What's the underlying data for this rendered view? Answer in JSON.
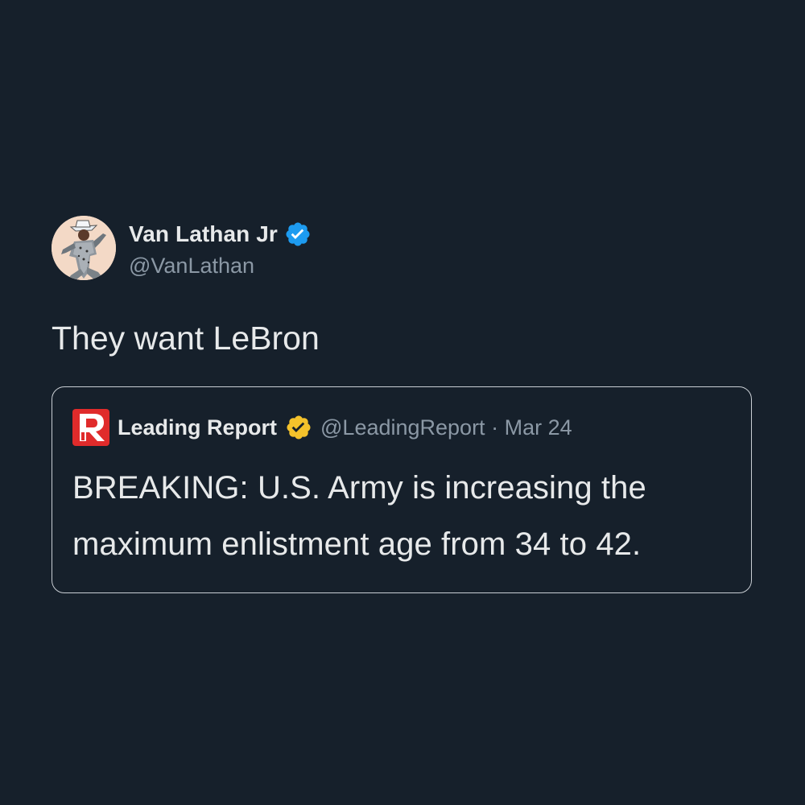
{
  "tweet": {
    "author": {
      "display_name": "Van Lathan Jr",
      "handle": "@VanLathan",
      "verified_color": "#1d9bf0",
      "avatar_icon": "profile-photo"
    },
    "text": "They want LeBron",
    "quoted": {
      "display_name": "Leading Report",
      "handle": "@LeadingReport",
      "separator": "·",
      "date": "Mar 24",
      "logo_letter": "R",
      "logo_color": "#e02b2b",
      "badge_color": "#f4c22b",
      "text": "BREAKING: U.S. Army is increasing the maximum enlistment age from 34 to 42."
    }
  },
  "colors": {
    "background": "#16202b",
    "text": "#e7e9ea",
    "muted": "#8b98a5",
    "card_border": "#c9ced4"
  }
}
